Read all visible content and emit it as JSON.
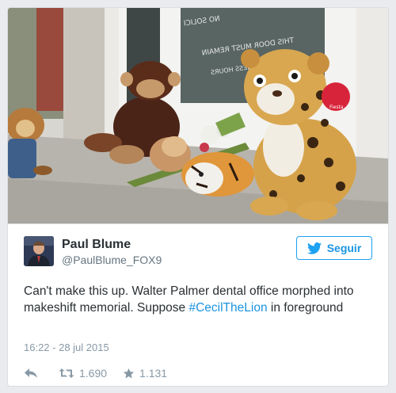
{
  "tweet": {
    "author_name": "Paul Blume",
    "author_handle": "@PaulBlume_FOX9",
    "follow_label": "Seguir",
    "text_before": "Can't make this up. Walter Palmer dental office morphed into makeshift memorial. Suppose ",
    "hashtag": "#CecilTheLion",
    "text_after": " in foreground",
    "timestamp": "16:22 - 28 jul 2015",
    "retweet_count": "1.690",
    "like_count": "1.131"
  },
  "photo": {
    "door_sign_lines": [
      "NO SOLICI",
      "THIS DOOR MUST REMAIN",
      "DURING BUSINESS HOURS"
    ],
    "tag_text": "Fiesta"
  },
  "icons": {
    "bird": "twitter-bird-icon",
    "reply": "reply-icon",
    "retweet": "retweet-icon",
    "like": "star-icon"
  },
  "colors": {
    "accent": "#1da1f2",
    "link": "#1b95e0",
    "text": "#292f33",
    "muted": "#8899a6"
  }
}
